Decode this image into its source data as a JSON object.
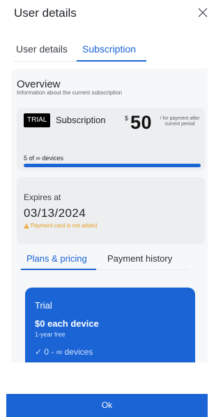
{
  "header": {
    "title": "User details"
  },
  "tabs": [
    {
      "label": "User details",
      "active": false
    },
    {
      "label": "Subscription",
      "active": true
    }
  ],
  "overview": {
    "title": "Overview",
    "subtitle": "Information about the current subscription"
  },
  "subscription_card": {
    "badge": "TRIAL",
    "label": "Subscription",
    "currency": "$",
    "price": "50",
    "price_note": "/ for payment after current period",
    "devices_text": "5 of ∞ devices",
    "progress": 1.0
  },
  "expiry_card": {
    "label": "Expires at",
    "date": "03/13/2024",
    "warning": "Payment card is not added"
  },
  "plan_tabs": [
    {
      "label": "Plans & pricing",
      "active": true
    },
    {
      "label": "Payment history",
      "active": false
    }
  ],
  "plan_card": {
    "name": "Trial",
    "price": "$0 each device",
    "free_note": "1-year free",
    "feature": "✓ 0 - ∞ devices"
  },
  "footer": {
    "ok_label": "Ok"
  },
  "colors": {
    "accent": "#1a64d6",
    "warning": "#e8a020",
    "panel": "#f6f7f8",
    "card": "#eceef0"
  }
}
